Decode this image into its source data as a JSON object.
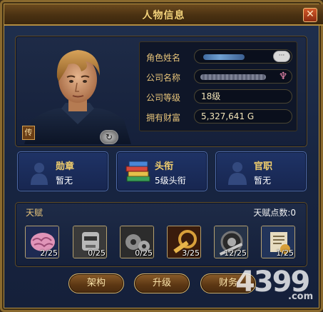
{
  "window": {
    "title": "人物信息"
  },
  "icons": {
    "close": "close-icon",
    "book": "book-icon",
    "switch": "swap-icon"
  },
  "book_label": "传",
  "chat_label": "···",
  "pink_icon_glyph": "♆",
  "info": {
    "rows": [
      {
        "label": "角色姓名",
        "value": ""
      },
      {
        "label": "公司名称",
        "value": ""
      },
      {
        "label": "公司等级",
        "value": "18级"
      },
      {
        "label": "拥有财富",
        "value": "5,327,641 G"
      }
    ]
  },
  "cards": [
    {
      "title": "勋章",
      "value": "暂无",
      "icon": "medal-silhouette-icon"
    },
    {
      "title": "头衔",
      "value": "5级头衔",
      "icon": "books-stack-icon"
    },
    {
      "title": "官职",
      "value": "暂无",
      "icon": "official-silhouette-icon"
    }
  ],
  "talent": {
    "title": "天赋",
    "points_label": "天赋点数:0",
    "skills": [
      {
        "count": "2/25",
        "icon": "brain-icon"
      },
      {
        "count": "0/25",
        "icon": "robot-head-icon"
      },
      {
        "count": "0/25",
        "icon": "gears-icon"
      },
      {
        "count": "3/25",
        "icon": "hammer-wheel-icon"
      },
      {
        "count": "12/25",
        "icon": "tire-wrench-icon"
      },
      {
        "count": "1/25",
        "icon": "document-shield-icon"
      }
    ]
  },
  "buttons": [
    {
      "label": "架构"
    },
    {
      "label": "升级"
    },
    {
      "label": "财务"
    }
  ],
  "watermark": {
    "brand": "4399",
    "domain": ".com"
  },
  "colors": {
    "frame_gold": "#b89344",
    "title_text": "#f4d27a",
    "card_title": "#f2cf6d",
    "wealth": "#f1e3b8"
  }
}
